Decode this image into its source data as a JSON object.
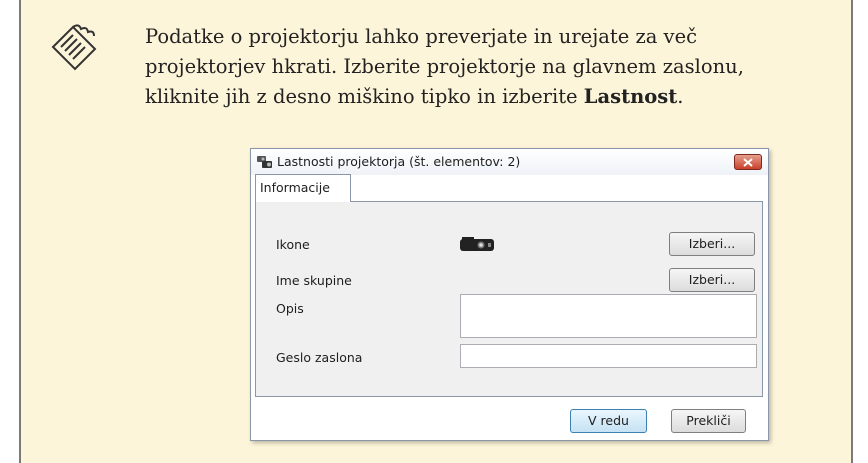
{
  "note": {
    "icon": "note-pencil-icon",
    "text_line1": "Podatke o projektorju lahko preverjate in urejate za več",
    "text_line2": "projektorjev hkrati. Izberite projektorje na glavnem zaslonu,",
    "text_line3_prefix": "kliknite jih z desno miškino tipko in izberite ",
    "text_line3_bold": "Lastnost",
    "text_line3_suffix": "."
  },
  "dialog": {
    "title": "Lastnosti projektorja (št. elementov: 2)",
    "title_icon": "projector-group-icon",
    "close_icon": "close-icon",
    "tab_label": "Informacije",
    "fields": {
      "icon_label": "Ikone",
      "icon_value": "projector-icon",
      "icon_button": "Izberi...",
      "group_label": "Ime skupine",
      "group_button": "Izberi...",
      "description_label": "Opis",
      "description_value": "",
      "password_label": "Geslo zaslona",
      "password_value": ""
    },
    "ok_button": "V redu",
    "cancel_button": "Prekliči"
  },
  "colors": {
    "note_background": "#fdf5d9",
    "close_button": "#c8402a"
  }
}
